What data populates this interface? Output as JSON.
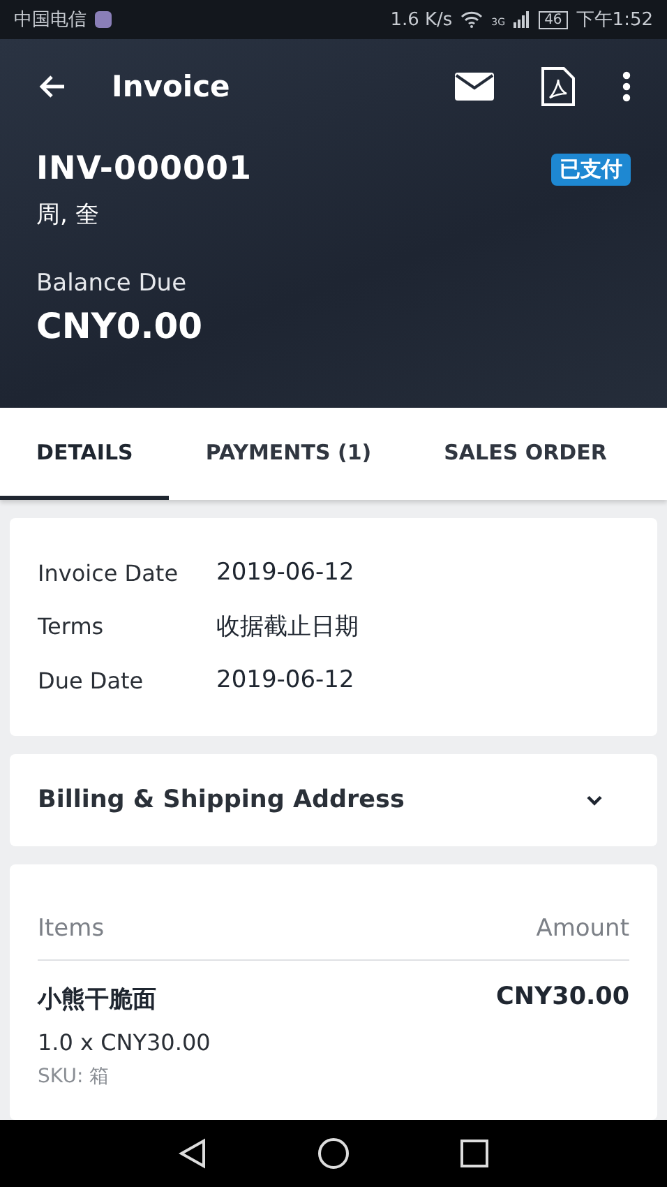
{
  "status_bar": {
    "carrier": "中国电信",
    "speed": "1.6 K/s",
    "network": "3G",
    "battery": "46",
    "time": "下午1:52"
  },
  "app_bar": {
    "title": "Invoice"
  },
  "invoice": {
    "number": "INV-000001",
    "status": "已支付",
    "customer": "周, 奎",
    "balance_label": "Balance Due",
    "balance": "CNY0.00"
  },
  "tabs": [
    {
      "label": "DETAILS",
      "selected": true
    },
    {
      "label": "PAYMENTS (1)",
      "selected": false
    },
    {
      "label": "SALES ORDER",
      "selected": false
    }
  ],
  "details": [
    {
      "label": "Invoice Date",
      "value": "2019-06-12"
    },
    {
      "label": "Terms",
      "value": "收据截止日期"
    },
    {
      "label": "Due Date",
      "value": "2019-06-12"
    }
  ],
  "address_section": {
    "title": "Billing & Shipping Address",
    "expanded": false
  },
  "items_table": {
    "columns": [
      "Items",
      "Amount"
    ],
    "rows": [
      {
        "name": "小熊干脆面",
        "amount": "CNY30.00",
        "quantity": "1.0 x CNY30.00",
        "sku": "SKU: 箱"
      }
    ]
  }
}
